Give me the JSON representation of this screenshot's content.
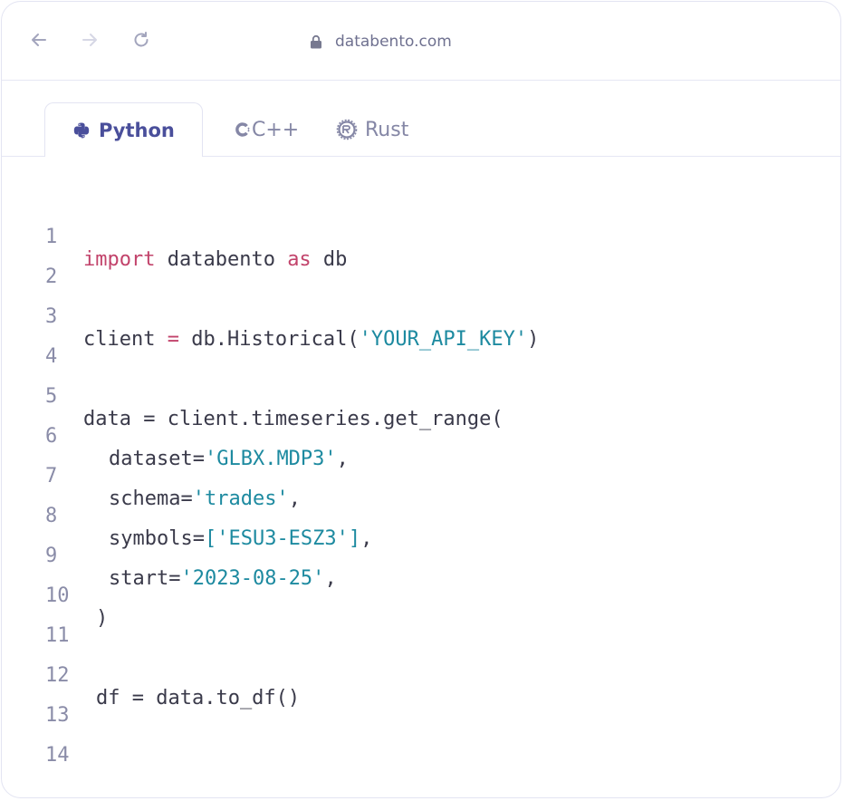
{
  "browser": {
    "url": "databento.com",
    "back_icon": "arrow-left-icon",
    "forward_icon": "arrow-right-icon",
    "reload_icon": "reload-icon",
    "lock_icon": "lock-icon"
  },
  "tabs": [
    {
      "label": "Python",
      "icon": "python-icon",
      "active": true
    },
    {
      "label": "C++",
      "icon": "cpp-icon",
      "active": false
    },
    {
      "label": "Rust",
      "icon": "rust-icon",
      "active": false
    }
  ],
  "colors": {
    "keyword": "#c2436b",
    "string": "#1d8aa0",
    "text": "#3a3a4a",
    "line_number": "#8a8ca8",
    "active_tab": "#4a4f9b"
  },
  "code": {
    "line_numbers": [
      "1",
      "2",
      "3",
      "4",
      "5",
      "6",
      "7",
      "8",
      "9",
      "10",
      "11",
      "12",
      "13",
      "14"
    ],
    "l1": {
      "kw1": "import",
      "t1": " databento ",
      "kw2": "as",
      "t2": " db"
    },
    "l3": {
      "t1": "client ",
      "op": "=",
      "t2": " db.Historical(",
      "s1": "'YOUR_API_KEY'",
      "t3": ")"
    },
    "l5": {
      "t1": "data = client.timeseries.get_range("
    },
    "l6": {
      "t1": "dataset=",
      "s1": "'GLBX.MDP3'",
      "t2": ","
    },
    "l7": {
      "t1": "schema=",
      "s1": "'trades'",
      "t2": ","
    },
    "l8": {
      "t1": "symbols=",
      "s1": "['ESU3-ESZ3']",
      "t2": ","
    },
    "l9": {
      "t1": "start=",
      "s1": "'2023-08-25'",
      "t2": ","
    },
    "l10": {
      "t1": ")"
    },
    "l12": {
      "t1": "df = data.to_df()"
    }
  }
}
